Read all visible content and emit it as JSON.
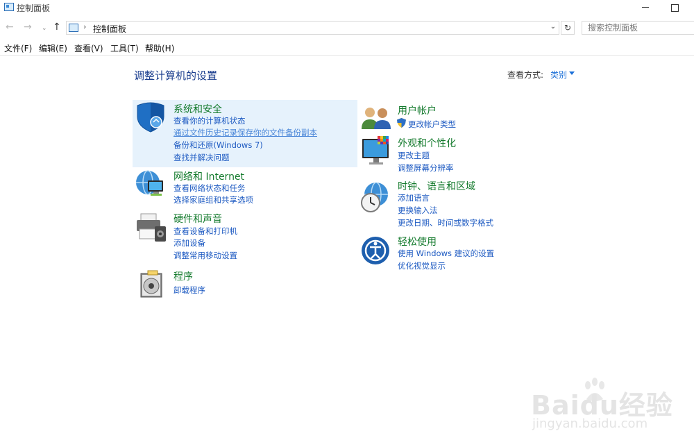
{
  "window": {
    "title": "控制面板"
  },
  "nav": {
    "back": "←",
    "forward": "→",
    "recent": "⌄",
    "up": "↑",
    "breadcrumb_sep": "›",
    "address": "控制面板",
    "dropdown": "⌄",
    "refresh": "↻",
    "search_placeholder": "搜索控制面板"
  },
  "menu": [
    "文件(F)",
    "编辑(E)",
    "查看(V)",
    "工具(T)",
    "帮助(H)"
  ],
  "main": {
    "heading": "调整计算机的设置",
    "view_by_label": "查看方式:",
    "view_by_value": "类别"
  },
  "categories": {
    "system": {
      "title": "系统和安全",
      "links": [
        "查看你的计算机状态",
        "通过文件历史记录保存你的文件备份副本",
        "备份和还原(Windows 7)",
        "查找并解决问题"
      ]
    },
    "network": {
      "title": "网络和 Internet",
      "links": [
        "查看网络状态和任务",
        "选择家庭组和共享选项"
      ]
    },
    "hardware": {
      "title": "硬件和声音",
      "links": [
        "查看设备和打印机",
        "添加设备",
        "调整常用移动设置"
      ]
    },
    "programs": {
      "title": "程序",
      "links": [
        "卸载程序"
      ]
    },
    "users": {
      "title": "用户帐户",
      "links": [
        "更改帐户类型"
      ]
    },
    "appearance": {
      "title": "外观和个性化",
      "links": [
        "更改主题",
        "调整屏幕分辨率"
      ]
    },
    "clock": {
      "title": "时钟、语言和区域",
      "links": [
        "添加语言",
        "更换输入法",
        "更改日期、时间或数字格式"
      ]
    },
    "ease": {
      "title": "轻松使用",
      "links": [
        "使用 Windows 建议的设置",
        "优化视觉显示"
      ]
    }
  },
  "watermark": {
    "brand": "Baidu经验",
    "url": "jingyan.baidu.com"
  },
  "colors": {
    "category_title": "#137a2c",
    "link": "#1d5ac2",
    "heading": "#1c3f8f",
    "highlight": "#e6f2fc"
  }
}
